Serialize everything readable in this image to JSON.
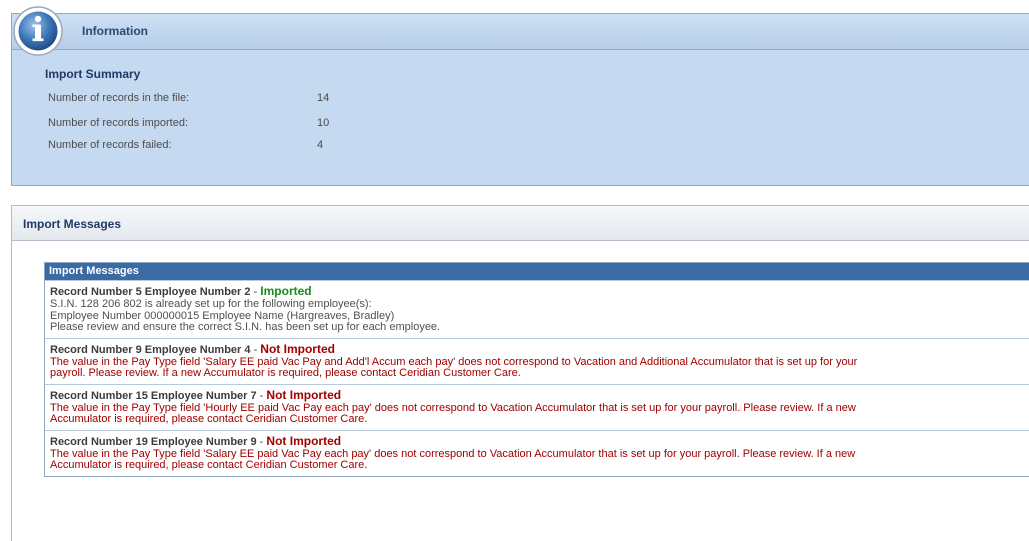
{
  "info": {
    "title": "Information",
    "summary_title": "Import Summary",
    "rows": [
      {
        "label": "Number of records in the file:",
        "value": "14"
      },
      {
        "label": "Number of records imported:",
        "value": "10"
      },
      {
        "label": "Number of records failed:",
        "value": "4"
      }
    ]
  },
  "messages_panel": {
    "title": "Import Messages",
    "table_header": "Import Messages",
    "records": [
      {
        "heading": "Record Number 5  Employee Number 2",
        "separator": " - ",
        "status": "Imported",
        "lines": [
          "S.I.N. 128 206 802 is already set up for the following employee(s):",
          "Employee Number 000000015 Employee Name (Hargreaves, Bradley)",
          "Please review and ensure the correct S.I.N. has been set up for each employee."
        ]
      },
      {
        "heading": "Record Number 9  Employee Number 4",
        "separator": " - ",
        "status": "Not Imported",
        "lines": [
          "The value in the Pay Type field 'Salary EE paid Vac Pay and Add'l Accum each pay' does not correspond to Vacation and Additional Accumulator that is set up for your",
          "payroll. Please review. If a new Accumulator is required, please contact Ceridian Customer Care."
        ]
      },
      {
        "heading": "Record Number 15  Employee Number 7",
        "separator": " - ",
        "status": "Not Imported",
        "lines": [
          "The value in the Pay Type field 'Hourly EE paid Vac Pay each pay' does not correspond to Vacation Accumulator that is set up for your payroll. Please review. If a new",
          "Accumulator is required, please contact Ceridian Customer Care."
        ]
      },
      {
        "heading": "Record Number 19  Employee Number 9",
        "separator": " - ",
        "status": "Not Imported",
        "lines": [
          "The value in the Pay Type field 'Salary EE paid Vac Pay each pay' does not correspond to Vacation Accumulator that is set up for your payroll. Please review. If a new",
          "Accumulator is required, please contact Ceridian Customer Care."
        ]
      }
    ]
  },
  "colors": {
    "info_bg": "#c5d9f0",
    "table_header_bg": "#3a6ba5",
    "status_imported": "#1a8a1a",
    "status_not_imported": "#a00000"
  },
  "icons": {
    "info": "info-circle-icon"
  }
}
